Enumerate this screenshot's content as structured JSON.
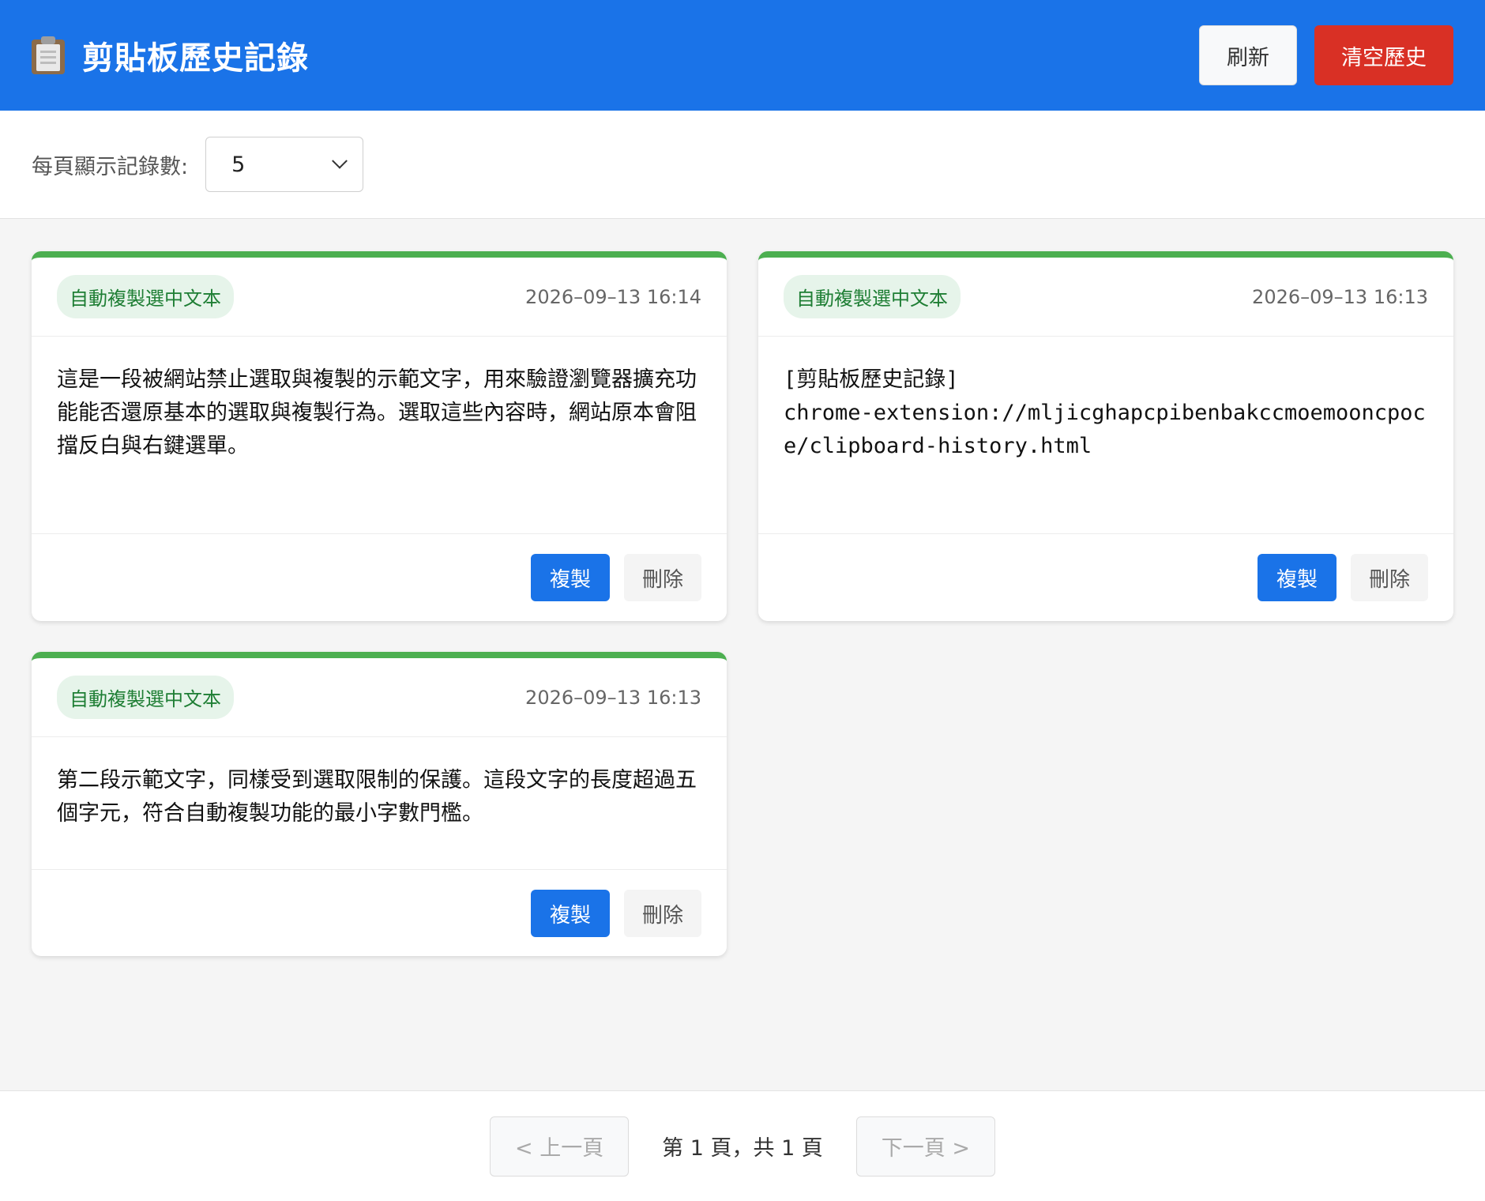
{
  "header": {
    "icon": "clipboard-icon",
    "title": "剪貼板歷史記錄",
    "refresh_label": "刷新",
    "clear_label": "清空歷史",
    "accent_color": "#1a73e8",
    "danger_color": "#d93025"
  },
  "toolbar": {
    "per_page_label": "每頁顯示記錄數:",
    "per_page_value": "5"
  },
  "records": [
    {
      "tag": "自動複製選中文本",
      "time": "2026–09–13 16:14",
      "content": "這是一段被網站禁止選取與複製的示範文字，用來驗證瀏覽器擴充功能能否還原基本的選取與複製行為。選取這些內容時，網站原本會阻擋反白與右鍵選單。",
      "copy_label": "複製",
      "delete_label": "刪除"
    },
    {
      "tag": "自動複製選中文本",
      "time": "2026–09–13 16:13",
      "content": "[剪貼板歷史記錄]\nchrome-extension://mljicghapcpibenbakccmoemooncpoce/clipboard-history.html",
      "copy_label": "複製",
      "delete_label": "刪除"
    },
    {
      "tag": "自動複製選中文本",
      "time": "2026–09–13 16:13",
      "content": "第二段示範文字，同樣受到選取限制的保護。這段文字的長度超過五個字元，符合自動複製功能的最小字數門檻。",
      "copy_label": "複製",
      "delete_label": "刪除"
    }
  ],
  "pagination": {
    "prev_label": "< 上一頁",
    "info": "第 1 頁，共 1 頁",
    "next_label": "下一頁 >"
  }
}
